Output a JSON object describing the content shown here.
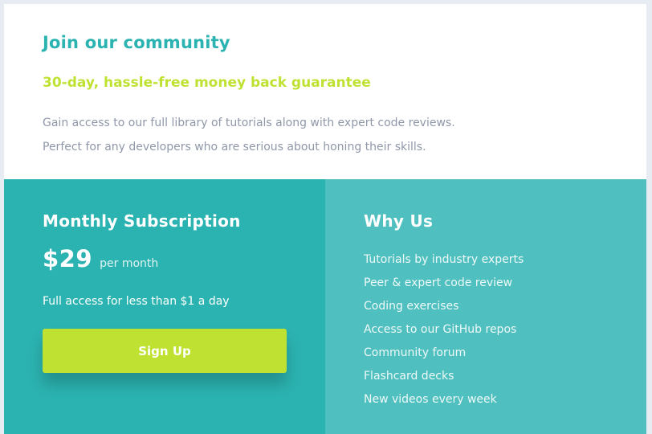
{
  "intro": {
    "heading": "Join our community",
    "guarantee": "30-day, hassle-free money back guarantee",
    "description_lines": [
      "Gain access to our full library of tutorials along with expert code reviews.",
      "Perfect for any developers who are serious about honing their skills."
    ]
  },
  "subscription": {
    "title": "Monthly Subscription",
    "price": "$29",
    "period": "per month",
    "note": "Full access for less than $1 a day",
    "button_label": "Sign Up"
  },
  "why_us": {
    "title": "Why Us",
    "items": [
      "Tutorials by industry experts",
      "Peer & expert code review",
      "Coding exercises",
      "Access to our GitHub repos",
      "Community forum",
      "Flashcard decks",
      "New videos every week"
    ]
  },
  "colors": {
    "accent_teal": "#2bb3b1",
    "light_teal": "#4fc0bf",
    "lime": "#bfe232",
    "body_text": "#8f97a8"
  }
}
